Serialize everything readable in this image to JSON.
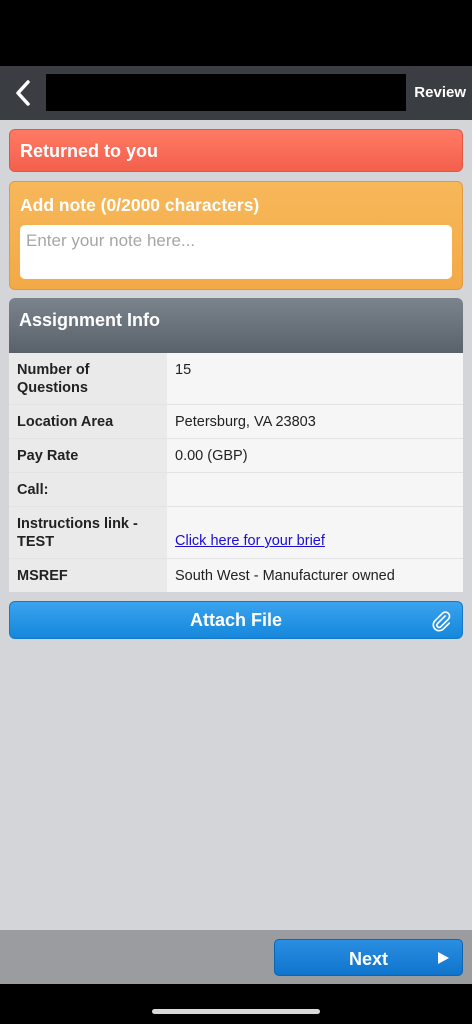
{
  "nav": {
    "review_label": "Review"
  },
  "status": {
    "returned_label": "Returned to you"
  },
  "note": {
    "title": "Add note (0/2000 characters)",
    "placeholder": "Enter your note here...",
    "value": ""
  },
  "assignment": {
    "header": "Assignment Info",
    "rows": [
      {
        "label": "Number of Questions",
        "value": "15"
      },
      {
        "label": "Location Area",
        "value": "Petersburg, VA 23803"
      },
      {
        "label": "Pay Rate",
        "value": "0.00 (GBP)"
      },
      {
        "label": "Call:",
        "value": ""
      },
      {
        "label": "Instructions link - TEST",
        "value": "Click here for your brief"
      },
      {
        "label": "MSREF",
        "value": "South West - Manufacturer owned"
      }
    ]
  },
  "actions": {
    "attach_label": "Attach File",
    "next_label": "Next"
  },
  "icons": {
    "back": "chevron-left-icon",
    "attach": "paperclip-icon",
    "next": "play-arrow-icon"
  },
  "colors": {
    "returned": "#f3604c",
    "note": "#f3a946",
    "header": "#59626a",
    "primary": "#1687dc"
  }
}
